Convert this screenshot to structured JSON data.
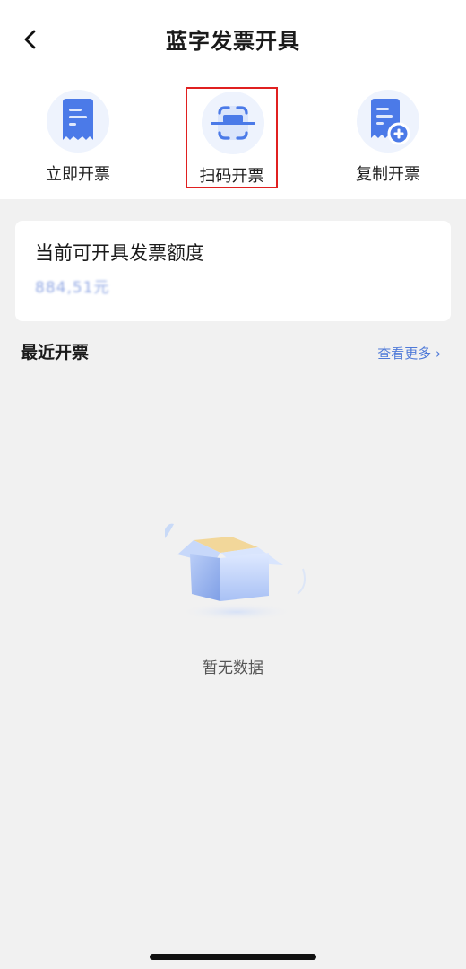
{
  "header": {
    "title": "蓝字发票开具",
    "back_icon": "chevron-left-icon"
  },
  "actions": [
    {
      "label": "立即开票",
      "icon": "invoice-document-icon"
    },
    {
      "label": "扫码开票",
      "icon": "scan-icon"
    },
    {
      "label": "复制开票",
      "icon": "copy-invoice-icon"
    }
  ],
  "quota": {
    "title": "当前可开具发票额度",
    "value": "884,51元"
  },
  "recent": {
    "title": "最近开票",
    "view_more": "查看更多 ›"
  },
  "empty": {
    "text": "暂无数据",
    "icon": "empty-box-icon"
  },
  "colors": {
    "accent": "#4e79d8",
    "icon_blue": "#4b7ae8",
    "highlight": "#e02020"
  }
}
